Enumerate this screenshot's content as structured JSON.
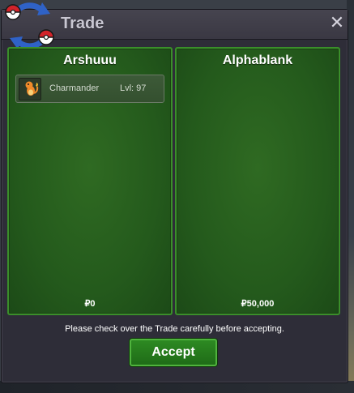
{
  "window": {
    "title": "Trade",
    "close_glyph": "✕"
  },
  "left_panel": {
    "trainer_name": "Arshuuu",
    "pokemon": [
      {
        "name": "Charmander",
        "level": "Lvl: 97",
        "icon": "charmander-sprite"
      }
    ],
    "money": "₽0"
  },
  "right_panel": {
    "trainer_name": "Alphablank",
    "pokemon": [],
    "money": "₽50,000"
  },
  "footer": {
    "notice": "Please check over the Trade carefully before accepting.",
    "accept_label": "Accept"
  },
  "colors": {
    "panel_green": "#2f6a22",
    "panel_border": "#3a8f2a",
    "accept_green": "#2d8a22",
    "window_bg": "#2e2d38",
    "pokeball_red": "#d2232a",
    "arrow_blue": "#2f62c7"
  }
}
